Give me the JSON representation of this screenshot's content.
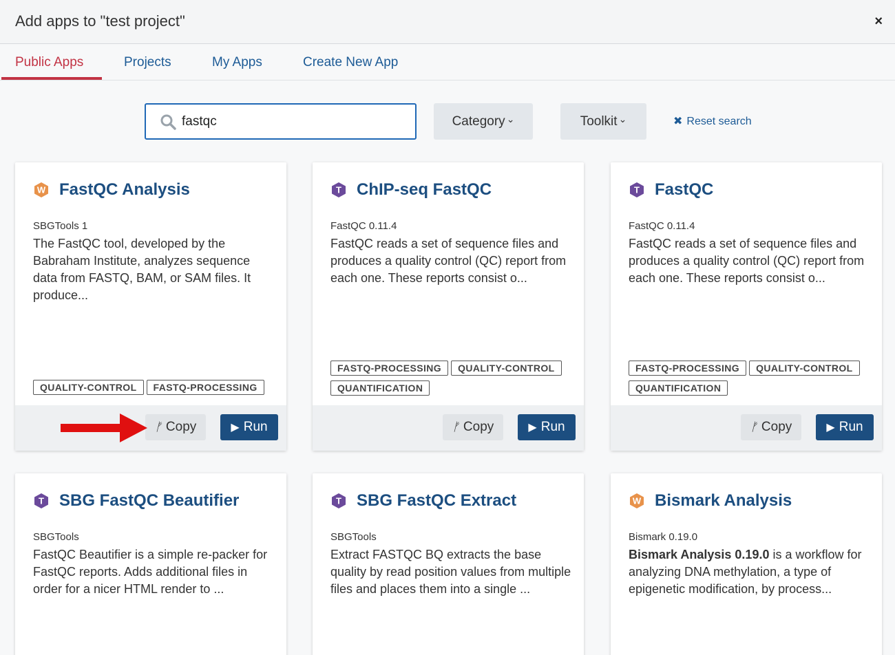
{
  "header": {
    "title": "Add apps to \"test project\"",
    "close_icon": "×"
  },
  "tabs": [
    {
      "label": "Public Apps",
      "active": true
    },
    {
      "label": "Projects",
      "active": false
    },
    {
      "label": "My Apps",
      "active": false
    },
    {
      "label": "Create New App",
      "active": false
    }
  ],
  "search": {
    "value": "fastqc",
    "placeholder": ""
  },
  "filters": {
    "category": "Category",
    "toolkit": "Toolkit",
    "chevron": "⌄"
  },
  "reset": {
    "icon": "✖",
    "label": "Reset search"
  },
  "buttons": {
    "copy": "Copy",
    "run": "Run"
  },
  "colors": {
    "accent": "#c23344",
    "link": "#1d5b96",
    "primary": "#1c4e80",
    "workflow_badge": "#e8924a",
    "tool_badge": "#6b4a9b",
    "annotation_arrow": "#e01010"
  },
  "cards": [
    {
      "badge": "W",
      "badge_type": "workflow",
      "title": "FastQC Analysis",
      "toolkit": "SBGTools 1",
      "description": "The FastQC tool, developed by the Babraham Institute, analyzes sequence data from FASTQ, BAM, or SAM files. It produce...",
      "tags": [
        "QUALITY-CONTROL",
        "FASTQ-PROCESSING"
      ]
    },
    {
      "badge": "T",
      "badge_type": "tool",
      "title": "ChIP-seq FastQC",
      "toolkit": "FastQC 0.11.4",
      "description": "FastQC reads a set of sequence files and produces a quality control (QC) report from each one. These reports consist o...",
      "tags": [
        "FASTQ-PROCESSING",
        "QUALITY-CONTROL",
        "QUANTIFICATION"
      ]
    },
    {
      "badge": "T",
      "badge_type": "tool",
      "title": "FastQC",
      "toolkit": "FastQC 0.11.4",
      "description": "FastQC reads a set of sequence files and produces a quality control (QC) report from each one. These reports consist o...",
      "tags": [
        "FASTQ-PROCESSING",
        "QUALITY-CONTROL",
        "QUANTIFICATION"
      ]
    },
    {
      "badge": "T",
      "badge_type": "tool",
      "title": "SBG FastQC Beautifier",
      "toolkit": "SBGTools",
      "description": "FastQC Beautifier is a simple re-packer for FastQC reports. Adds additional files in order for a nicer HTML render to ..."
    },
    {
      "badge": "T",
      "badge_type": "tool",
      "title": "SBG FastQC Extract",
      "toolkit": "SBGTools",
      "description": "Extract FASTQC BQ extracts the base quality by read position values from multiple files and places them into a single ..."
    },
    {
      "badge": "W",
      "badge_type": "workflow",
      "title": "Bismark Analysis",
      "toolkit": "Bismark 0.19.0",
      "description_bold": "Bismark Analysis 0.19.0",
      "description": " is a workflow for analyzing DNA methylation, a type of epigenetic modification, by process..."
    }
  ]
}
